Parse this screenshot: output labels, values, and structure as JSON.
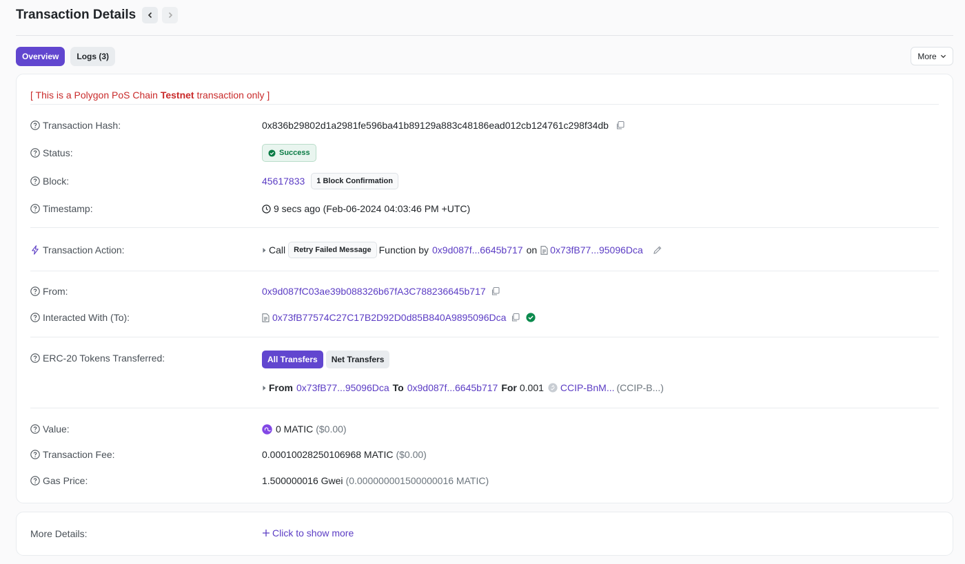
{
  "header": {
    "title": "Transaction Details"
  },
  "tabs": [
    {
      "label": "Overview"
    },
    {
      "label": "Logs (3)"
    }
  ],
  "more_button": {
    "label": "More"
  },
  "testnet_notice": {
    "prefix": "[ This is a Polygon PoS Chain ",
    "bold": "Testnet",
    "suffix": " transaction only ]"
  },
  "rows": {
    "tx_hash": {
      "label": "Transaction Hash:",
      "value": "0x836b29802d1a2981fe596ba41b89129a883c48186ead012cb124761c298f34db"
    },
    "status": {
      "label": "Status:",
      "value": "Success"
    },
    "block": {
      "label": "Block:",
      "value": "45617833",
      "confirmation": "1 Block Confirmation"
    },
    "timestamp": {
      "label": "Timestamp:",
      "value": "9 secs ago (Feb-06-2024 04:03:46 PM +UTC)"
    },
    "action": {
      "label": "Transaction Action:",
      "call": "Call",
      "method": "Retry Failed Message",
      "function_by": "Function by",
      "caller": "0x9d087f...6645b717",
      "on": "on",
      "contract": "0x73fB77...95096Dca"
    },
    "from": {
      "label": "From:",
      "value": "0x9d087fC03ae39b088326b67fA3C788236645b717"
    },
    "to": {
      "label": "Interacted With (To):",
      "value": "0x73fB77574C27C17B2D92D0d85B840A9895096Dca"
    },
    "erc20": {
      "label": "ERC-20 Tokens Transferred:",
      "tabs": [
        "All Transfers",
        "Net Transfers"
      ],
      "transfer": {
        "from_label": "From",
        "from": "0x73fB77...95096Dca",
        "to_label": "To",
        "to": "0x9d087f...6645b717",
        "for_label": "For",
        "amount": "0.001",
        "token": "CCIP-BnM...",
        "symbol": "(CCIP-B...)"
      }
    },
    "value": {
      "label": "Value:",
      "amount": "0 MATIC",
      "usd": "($0.00)"
    },
    "fee": {
      "label": "Transaction Fee:",
      "amount": "0.00010028250106968 MATIC",
      "usd": "($0.00)"
    },
    "gas_price": {
      "label": "Gas Price:",
      "amount": "1.500000016 Gwei",
      "detail": "(0.000000001500000016 MATIC)"
    }
  },
  "more_details": {
    "label": "More Details:",
    "action": "Click to show more"
  },
  "colors": {
    "accent": "#6146cf",
    "link": "#5b3cc4",
    "success": "#0b7b45",
    "testnet": "#c92a2a"
  }
}
